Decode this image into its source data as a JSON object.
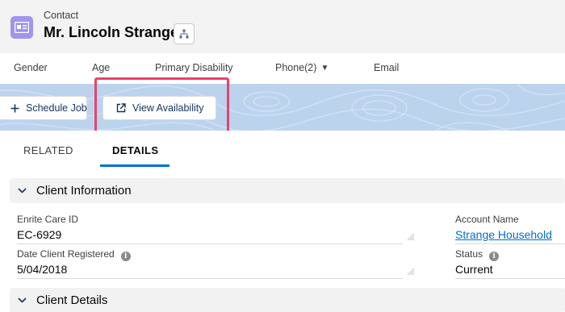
{
  "header": {
    "record_type": "Contact",
    "record_name": "Mr. Lincoln Strange",
    "icon": "contact-card-icon",
    "hierarchy_icon": "hierarchy-icon"
  },
  "highlights": {
    "fields": [
      "Gender",
      "Age",
      "Primary Disability",
      "Phone(2)",
      "Email"
    ]
  },
  "actions": {
    "schedule_job": "Schedule Job",
    "view_availability": "View Availability"
  },
  "tabs": {
    "related": "RELATED",
    "details": "DETAILS",
    "active": "DETAILS"
  },
  "sections": {
    "client_information": "Client Information",
    "client_details": "Client Details"
  },
  "fields": {
    "enrite_care_id_label": "Enrite Care ID",
    "enrite_care_id_value": "EC-6929",
    "date_registered_label": "Date Client Registered",
    "date_registered_value": "5/04/2018",
    "account_name_label": "Account Name",
    "account_name_value": "Strange Household",
    "status_label": "Status",
    "status_value": "Current"
  },
  "colors": {
    "contact_icon": "#a094ed",
    "highlight_outline": "#e8436a",
    "active_tab": "#0070d2",
    "link": "#006dcc"
  }
}
